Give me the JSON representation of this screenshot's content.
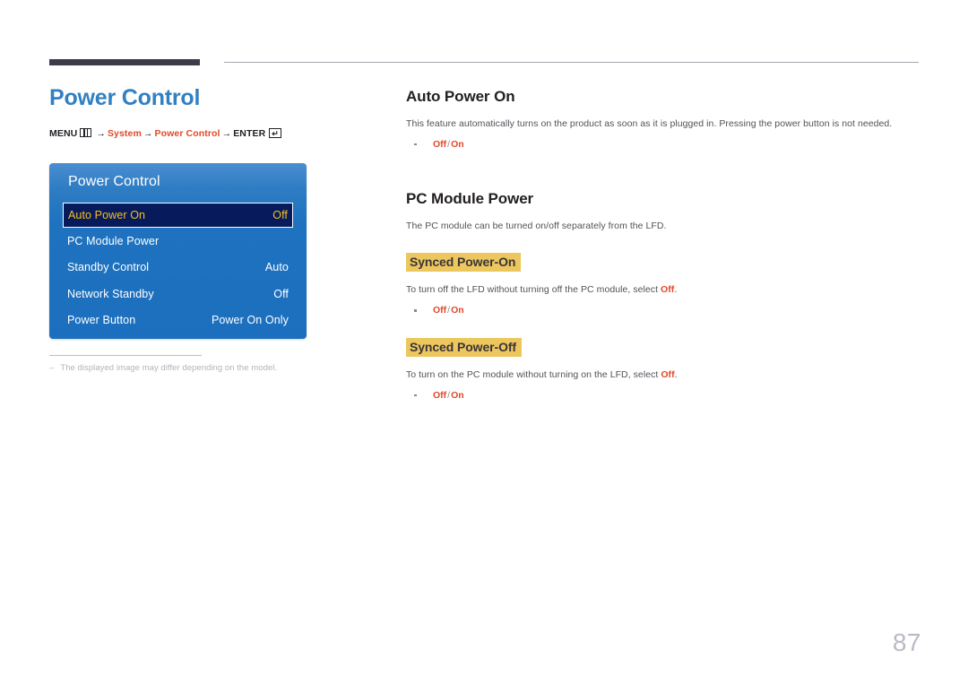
{
  "document": {
    "page_number": "87",
    "title": "Power Control",
    "title_color": "#3280c2",
    "accent_color": "#e0492a",
    "highlight_color": "#ecc75e"
  },
  "breadcrumb": {
    "menu_label": "MENU",
    "menu_icon": "menu-grid-icon",
    "arrow": "→",
    "step1": "System",
    "step2": "Power Control",
    "enter_label": "ENTER",
    "enter_icon": "enter-return-icon",
    "enter_glyph": "↵"
  },
  "osd": {
    "title": "Power Control",
    "rows": [
      {
        "label": "Auto Power On",
        "value": "Off",
        "selected": true
      },
      {
        "label": "PC Module Power",
        "value": "",
        "selected": false
      },
      {
        "label": "Standby Control",
        "value": "Auto",
        "selected": false
      },
      {
        "label": "Network Standby",
        "value": "Off",
        "selected": false
      },
      {
        "label": "Power Button",
        "value": "Power On Only",
        "selected": false
      }
    ]
  },
  "footnote": {
    "dash": "–",
    "text": "The displayed image may differ depending on the model."
  },
  "sections": [
    {
      "heading": "Auto Power On",
      "body": "This feature automatically turns on the product as soon as it is plugged in. Pressing the power button is not needed.",
      "options": {
        "first": "Off",
        "sep": "/",
        "second": "On"
      }
    },
    {
      "heading": "PC Module Power",
      "body": "The PC module can be turned on/off separately from the LFD.",
      "subsections": [
        {
          "subheading": "Synced Power-On",
          "body_pre": "To turn off the LFD without turning off the PC module, select ",
          "body_hl": "Off",
          "body_post": ".",
          "options": {
            "first": "Off",
            "sep": "/",
            "second": "On"
          }
        },
        {
          "subheading": "Synced Power-Off",
          "body_pre": "To turn on the PC module without turning on the LFD, select ",
          "body_hl": "Off",
          "body_post": ".",
          "options": {
            "first": "Off",
            "sep": "/",
            "second": "On"
          }
        }
      ]
    }
  ]
}
